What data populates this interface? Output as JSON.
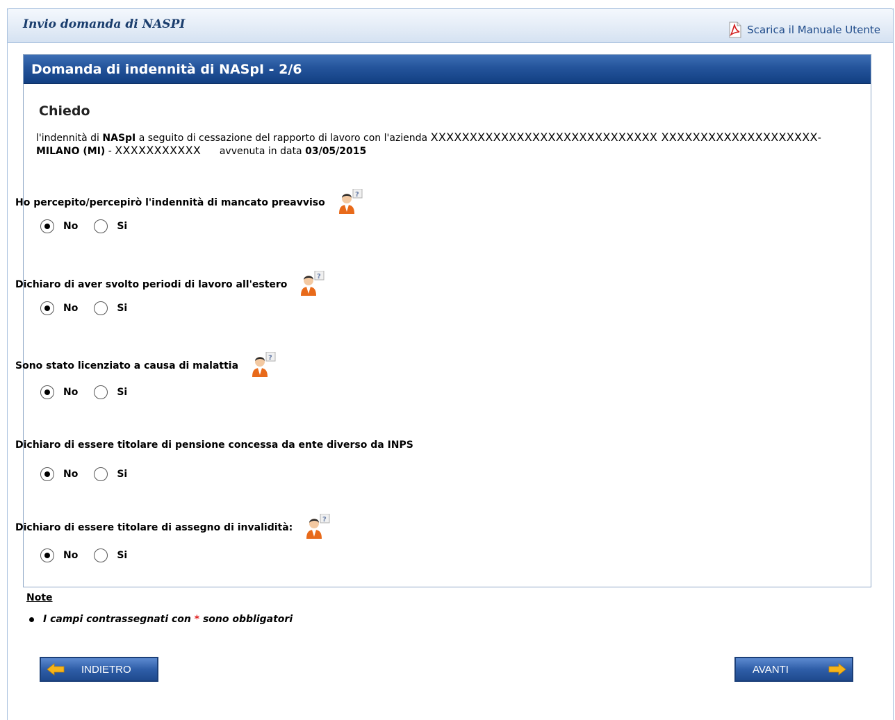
{
  "header": {
    "title": "Invio domanda di NASPI",
    "manual_link": "Scarica il Manuale Utente"
  },
  "panel": {
    "title": "Domanda di indennità di NASpI - 2/6",
    "heading": "Chiedo",
    "intro": {
      "text_1": "l'indennità di ",
      "bold_1": "NASpI",
      "text_2": " a seguito di cessazione del rapporto di lavoro con l'azienda ",
      "company_masked": "XXXXXXXXXXXXXXXXXXXXXXXXXXXXX XXXXXXXXXXXXXXXXXXXX",
      "sep_1": "- ",
      "city": "MILANO (MI)",
      "sep_2": " - ",
      "code_masked": "XXXXXXXXXXX",
      "text_3": "      avvenuta in data ",
      "date": "03/05/2015"
    },
    "questions": [
      {
        "label": "Ho percepito/percepirò l'indennità di mancato preavviso",
        "has_help": true,
        "selected": "No"
      },
      {
        "label": "Dichiaro di aver svolto periodi di lavoro all'estero",
        "has_help": true,
        "selected": "No"
      },
      {
        "label": "Sono stato licenziato a causa di malattia",
        "has_help": true,
        "selected": "No"
      },
      {
        "label": "Dichiaro di essere titolare di pensione concessa da ente diverso da INPS",
        "has_help": false,
        "selected": "No"
      },
      {
        "label": "Dichiaro di essere titolare di assegno di invalidità:",
        "has_help": true,
        "selected": "No"
      }
    ],
    "options": {
      "no": "No",
      "si": "Si"
    }
  },
  "notes": {
    "title": "Note",
    "item_before": "I campi contrassegnati con ",
    "star": "*",
    "item_after": " sono obbligatori"
  },
  "buttons": {
    "back": "INDIETRO",
    "next": "AVANTI"
  },
  "icons": {
    "manual": "pdf-icon",
    "help": "help-person-icon",
    "back": "arrow-left-icon",
    "next": "arrow-right-icon"
  },
  "colors": {
    "panel_header": "#24549b",
    "topbar_title": "#1a3d6d",
    "required_star": "#e02020",
    "arrow": "#f7b51a"
  }
}
